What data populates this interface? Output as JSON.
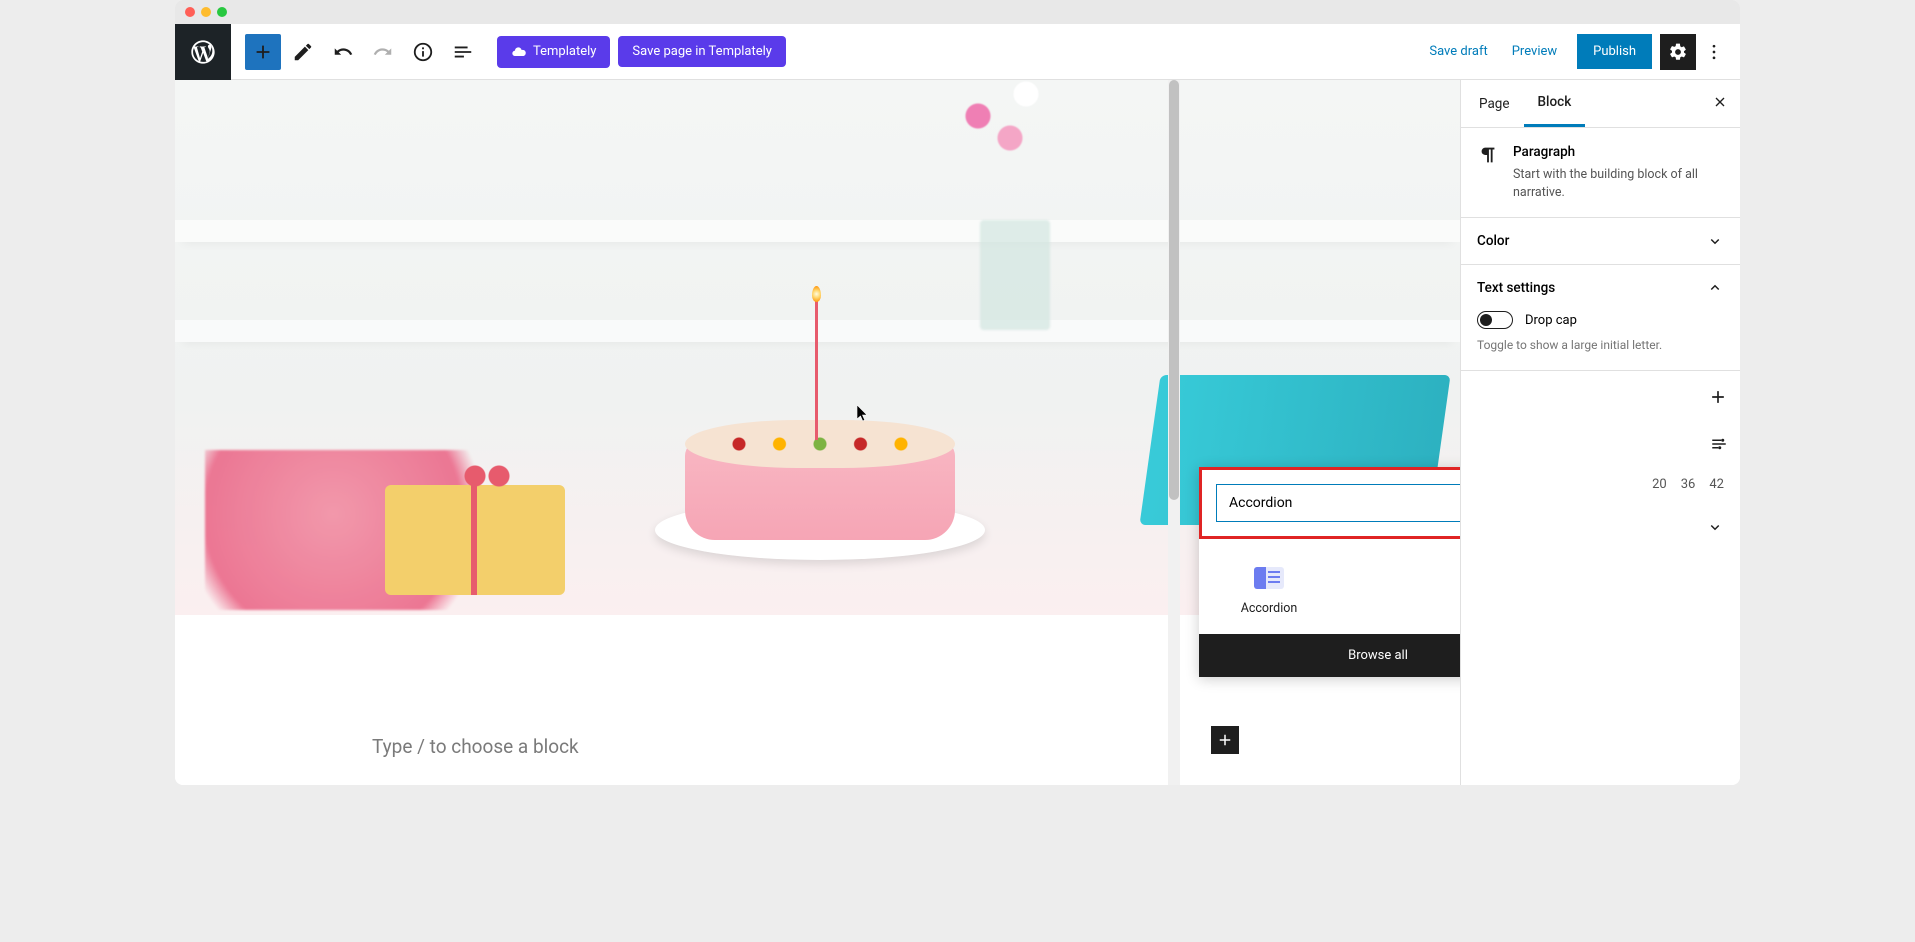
{
  "toolbar": {
    "templately_label": "Templately",
    "save_templately_label": "Save page in Templately",
    "save_draft_label": "Save draft",
    "preview_label": "Preview",
    "publish_label": "Publish"
  },
  "canvas": {
    "paragraph_prompt": "Type / to choose a block"
  },
  "inserter": {
    "search_value": "Accordion",
    "result_label": "Accordion",
    "browse_all_label": "Browse all"
  },
  "sidebar": {
    "tabs": {
      "page": "Page",
      "block": "Block"
    },
    "block_info": {
      "title": "Paragraph",
      "description": "Start with the building block of all narrative."
    },
    "panels": {
      "color": {
        "title": "Color"
      },
      "text_settings": {
        "title": "Text settings",
        "drop_cap_label": "Drop cap",
        "drop_cap_help": "Toggle to show a large initial letter."
      }
    },
    "font_sizes": [
      "20",
      "36",
      "42"
    ]
  }
}
